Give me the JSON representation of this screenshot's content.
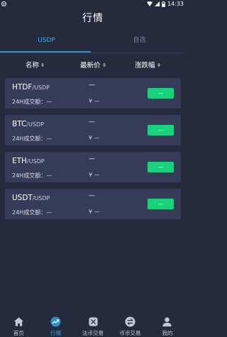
{
  "status_bar": {
    "time": "14:33"
  },
  "header": {
    "title": "行情"
  },
  "tabs": [
    {
      "label": "USDP",
      "active": true
    },
    {
      "label": "自选",
      "active": false
    }
  ],
  "columns": {
    "name": "名称",
    "price": "最新价",
    "change": "涨跌幅"
  },
  "markets": [
    {
      "base": "HTDF",
      "quote": "/USDP",
      "price": "—",
      "volume": "24H成交额：—",
      "cny": "¥ —",
      "change": "—"
    },
    {
      "base": "BTC",
      "quote": "/USDP",
      "price": "—",
      "volume": "24H成交额：—",
      "cny": "¥ —",
      "change": "—"
    },
    {
      "base": "ETH",
      "quote": "/USDP",
      "price": "—",
      "volume": "24H成交额：—",
      "cny": "¥ —",
      "change": "—"
    },
    {
      "base": "USDT",
      "quote": "/USDP",
      "price": "—",
      "volume": "24H成交额：—",
      "cny": "¥ —",
      "change": "—"
    }
  ],
  "bottom_nav": [
    {
      "label": "首页",
      "icon": "home-icon",
      "active": false
    },
    {
      "label": "行情",
      "icon": "market-trend-icon",
      "active": true
    },
    {
      "label": "法币交易",
      "icon": "fiat-trade-icon",
      "active": false
    },
    {
      "label": "币币交易",
      "icon": "coin-exchange-icon",
      "active": false
    },
    {
      "label": "我的",
      "icon": "user-icon",
      "active": false
    }
  ],
  "colors": {
    "background": "#262a3d",
    "card": "#363b57",
    "accent": "#3aa9e8",
    "rise": "#19d27e"
  }
}
